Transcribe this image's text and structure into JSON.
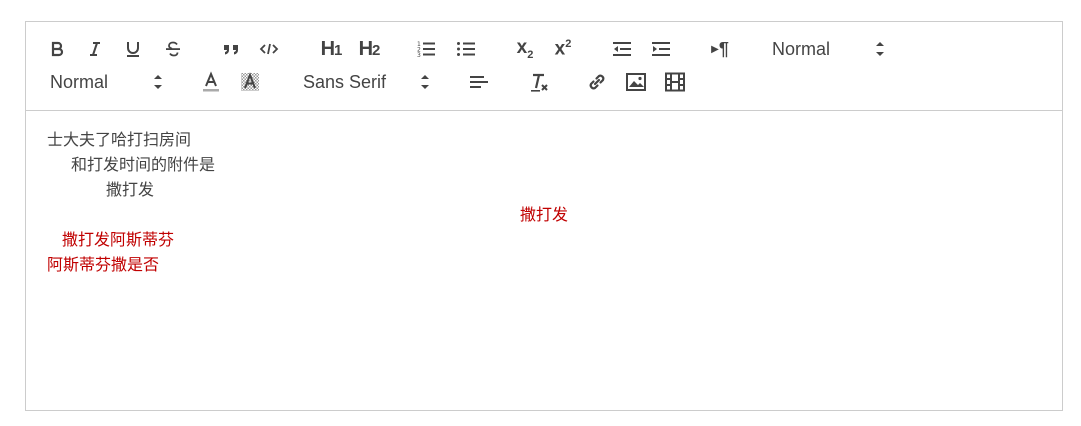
{
  "toolbar": {
    "header_picker": {
      "selected": "Normal"
    },
    "size_picker": {
      "selected": "Normal"
    },
    "font_picker": {
      "selected": "Sans Serif"
    },
    "buttons": {
      "h1": "H1",
      "h2": "H2",
      "sub": "x2",
      "sup": "x2",
      "rtl": "¶"
    }
  },
  "content": {
    "lines": [
      "士大夫了哈打扫房间",
      "和打发时间的附件是",
      "撒打发",
      "撒打发",
      "撒打发阿斯蒂芬",
      "阿斯蒂芬撒是否"
    ]
  },
  "colors": {
    "text": "#444444",
    "red_text": "#c00000",
    "border": "#cccccc"
  }
}
